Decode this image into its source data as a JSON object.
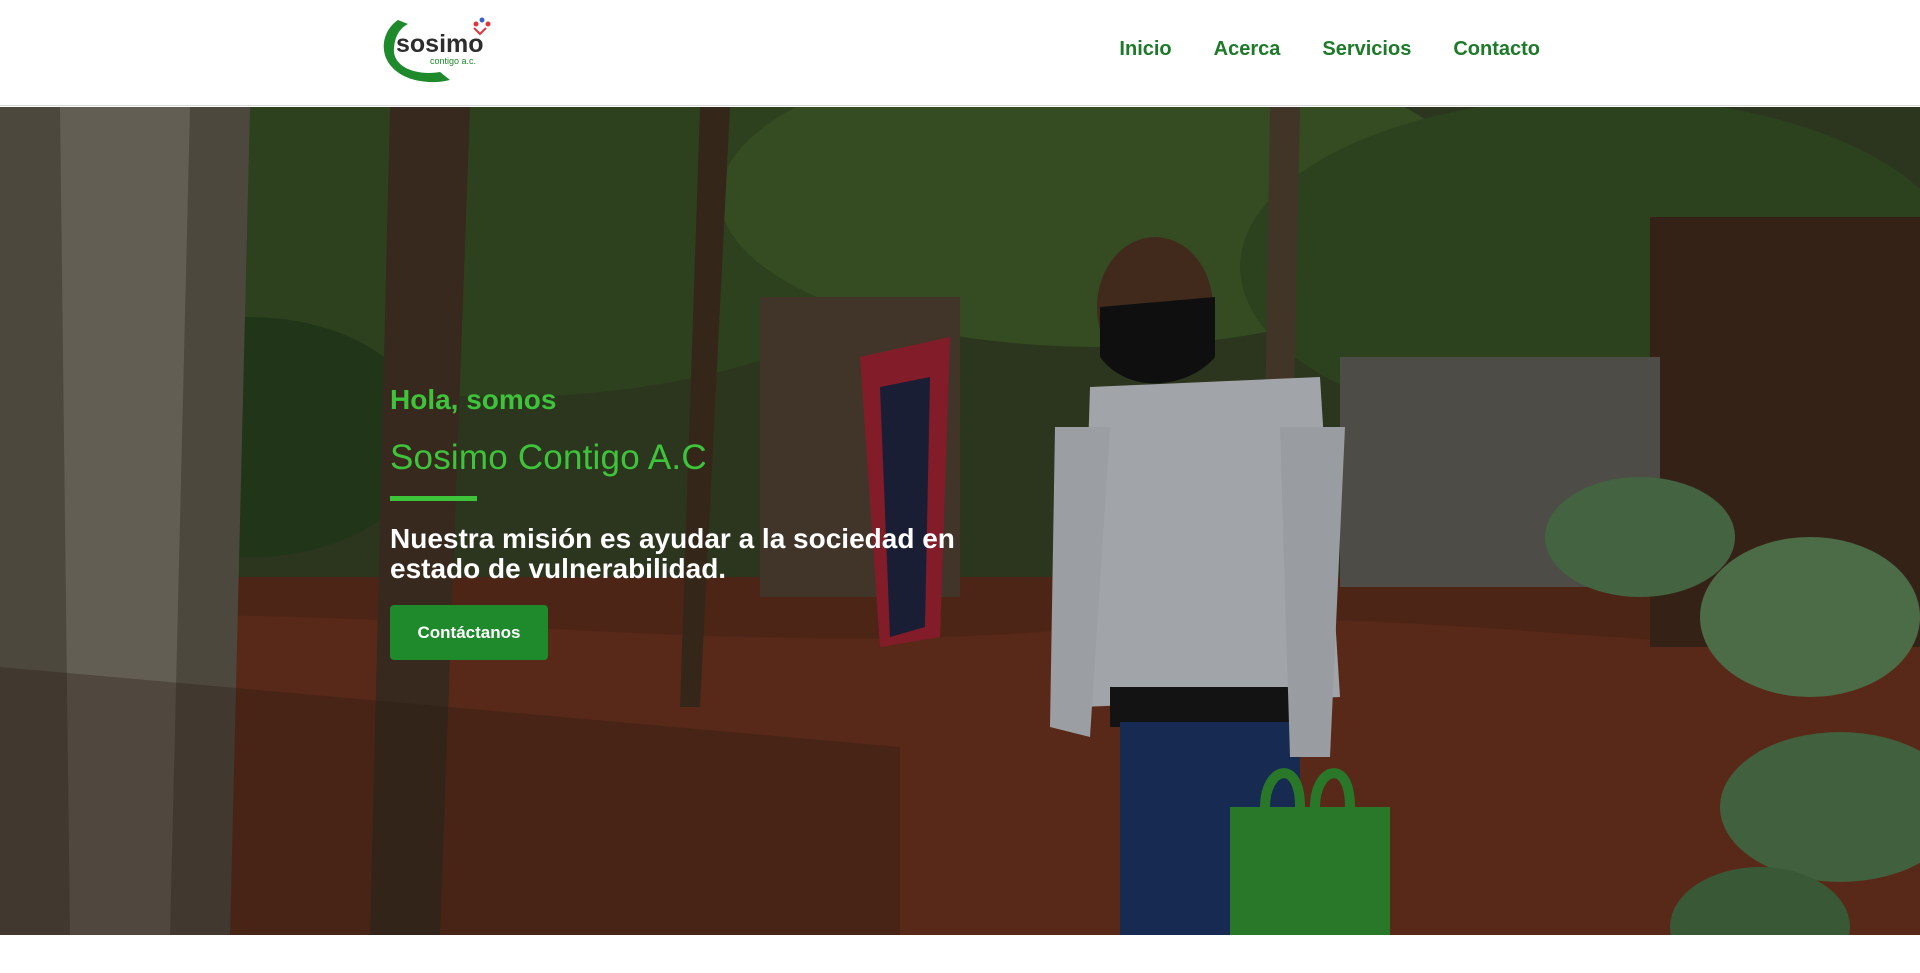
{
  "logo": {
    "main_text": "sosimo",
    "sub_text": "contigo a.c."
  },
  "nav": {
    "items": [
      "Inicio",
      "Acerca",
      "Servicios",
      "Contacto"
    ]
  },
  "hero": {
    "kicker": "Hola, somos",
    "title": "Sosimo Contigo A.C",
    "mission": "Nuestra misión es ayudar a la sociedad en estado de vulnerabilidad.",
    "cta_label": "Contáctanos",
    "image_subject": "volunteer-with-mask-holding-green-bag"
  },
  "colors": {
    "accent_green": "#3ec43a",
    "nav_green": "#1d7a28",
    "button_green": "#1e8a2b",
    "text_white": "#ffffff"
  }
}
